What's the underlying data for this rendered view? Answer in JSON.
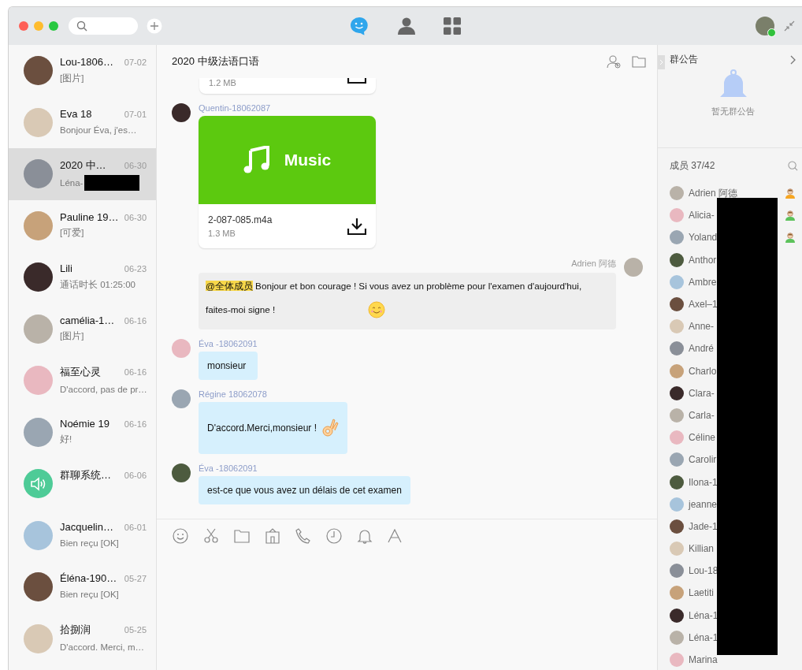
{
  "toolbar": {
    "nav": [
      {
        "kind": "chat",
        "selected": true
      },
      {
        "kind": "contacts",
        "selected": false
      },
      {
        "kind": "apps",
        "selected": false
      }
    ]
  },
  "conversations": [
    {
      "name": "Lou-1806…",
      "time": "07-02",
      "preview": "[图片]",
      "kind": "photo",
      "selected": false
    },
    {
      "name": "Eva 18",
      "time": "07-01",
      "preview": "Bonjour Éva, j'es…",
      "kind": "photo",
      "selected": false
    },
    {
      "name": "2020 中…",
      "time": "06-30",
      "preview": "Léna-",
      "kind": "photo",
      "selected": true,
      "redacted": true
    },
    {
      "name": "Pauline 19…",
      "time": "06-30",
      "preview": "[可爱]",
      "kind": "photo",
      "selected": false
    },
    {
      "name": "Lili",
      "time": "06-23",
      "preview": "通话时长 01:25:00",
      "kind": "photo",
      "selected": false
    },
    {
      "name": "camélia-1…",
      "time": "06-16",
      "preview": "[图片]",
      "kind": "photo",
      "selected": false
    },
    {
      "name": "福至心灵",
      "time": "06-16",
      "preview": "D'accord, pas de pr…",
      "kind": "photo",
      "selected": false
    },
    {
      "name": "Noémie 19",
      "time": "06-16",
      "preview": "好!",
      "kind": "photo",
      "selected": false
    },
    {
      "name": "群聊系统…",
      "time": "06-06",
      "kind": "system",
      "selected": false
    },
    {
      "name": "Jacquelin…",
      "time": "06-01",
      "preview": "Bien reçu [OK]",
      "kind": "photo",
      "selected": false
    },
    {
      "name": "Éléna-190…",
      "time": "05-27",
      "preview": "Bien reçu [OK]",
      "kind": "photo",
      "selected": false
    },
    {
      "name": "拾捌润",
      "time": "05-25",
      "preview": "D'accord. Merci, m…",
      "kind": "photo",
      "selected": false
    }
  ],
  "chat": {
    "title": "2020 中级法语口语",
    "messages": [
      {
        "kind": "file_partial",
        "size": "1.2 MB"
      },
      {
        "kind": "file",
        "outgoing": false,
        "sender": "Quentin-18062087",
        "banner": "Music",
        "filename": "2-087-085.m4a",
        "size": "1.3 MB"
      },
      {
        "kind": "text",
        "outgoing": true,
        "sender": "Adrien 阿德",
        "mention": "@全体成员",
        "text": "Bonjour et bon courage ! Si vous avez un problème pour l'examen d'aujourd'hui, faites-moi signe !",
        "emoji": {
          "kind": "smile"
        }
      },
      {
        "kind": "text",
        "outgoing": false,
        "sender": "Éva -18062091",
        "text": "monsieur"
      },
      {
        "kind": "text",
        "outgoing": false,
        "sender": "Régine 18062078",
        "text": "D'accord.Merci,monsieur !",
        "emoji": {
          "kind": "ok"
        }
      },
      {
        "kind": "text",
        "outgoing": false,
        "sender": "Éva -18062091",
        "text": "est-ce que vous avez un délais de cet examen"
      }
    ]
  },
  "announcement": {
    "title": "群公告",
    "empty_text": "暂无群公告"
  },
  "members": {
    "title": "成员 37/42",
    "list": [
      {
        "name": "Adrien 阿德",
        "kind": "owner"
      },
      {
        "name": "Alicia-",
        "kind": "admin"
      },
      {
        "name": "Yoland",
        "kind": "admin"
      },
      {
        "name": "Anthor",
        "kind": "member"
      },
      {
        "name": "Ambre",
        "kind": "member"
      },
      {
        "name": "Axel–1",
        "kind": "member"
      },
      {
        "name": "Anne-",
        "kind": "member"
      },
      {
        "name": "André",
        "kind": "member"
      },
      {
        "name": "Charlo",
        "kind": "member"
      },
      {
        "name": "Clara-",
        "kind": "member"
      },
      {
        "name": "Carla-",
        "kind": "member"
      },
      {
        "name": "Céline",
        "kind": "member"
      },
      {
        "name": "Carolir",
        "kind": "member"
      },
      {
        "name": "Ilona-1",
        "kind": "member"
      },
      {
        "name": "jeanne",
        "kind": "member"
      },
      {
        "name": "Jade-1",
        "kind": "member"
      },
      {
        "name": "Killian",
        "kind": "member"
      },
      {
        "name": "Lou-18",
        "kind": "member"
      },
      {
        "name": "Laetiti",
        "kind": "member"
      },
      {
        "name": "Léna-1",
        "kind": "member"
      },
      {
        "name": "Léna-1",
        "kind": "member"
      },
      {
        "name": "Marina",
        "kind": "member"
      }
    ],
    "redacted": true
  }
}
